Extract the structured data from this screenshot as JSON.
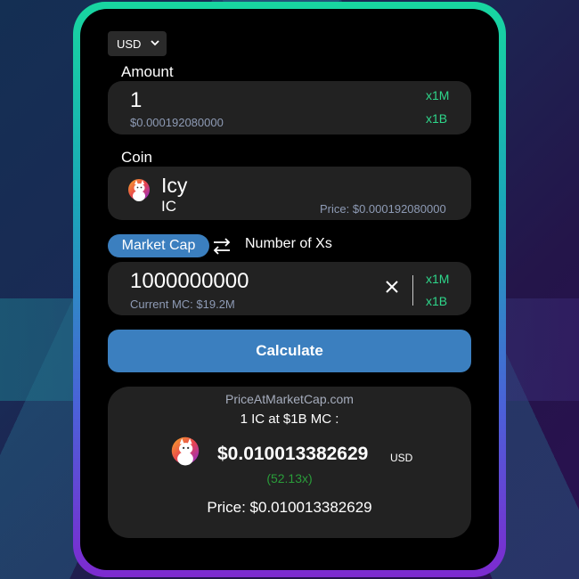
{
  "currency": {
    "selected": "USD"
  },
  "amount": {
    "label": "Amount",
    "value": "1",
    "usd_value": "$0.000192080000",
    "mult_1": "x1M",
    "mult_2": "x1B"
  },
  "coin": {
    "label": "Coin",
    "name": "Icy",
    "symbol": "IC",
    "price": "Price: $0.000192080000",
    "icon": "cat-coin-icon"
  },
  "mode": {
    "active": "Market Cap",
    "inactive": "Number of Xs",
    "swap_icon": "swap-arrows-icon"
  },
  "market_cap": {
    "value": "1000000000",
    "current": "Current MC: $19.2M",
    "mult_1": "x1M",
    "mult_2": "x1B"
  },
  "calculate_label": "Calculate",
  "result": {
    "site": "PriceAtMarketCap.com",
    "heading": "1 IC at $1B MC :",
    "price_big": "$0.010013382629",
    "price_unit": "USD",
    "multiplier": "(52.13x)",
    "price_line": "Price: $0.010013382629"
  },
  "colors": {
    "accent": "#3b7fbf",
    "green": "#2ed68a",
    "panel": "#222222"
  }
}
